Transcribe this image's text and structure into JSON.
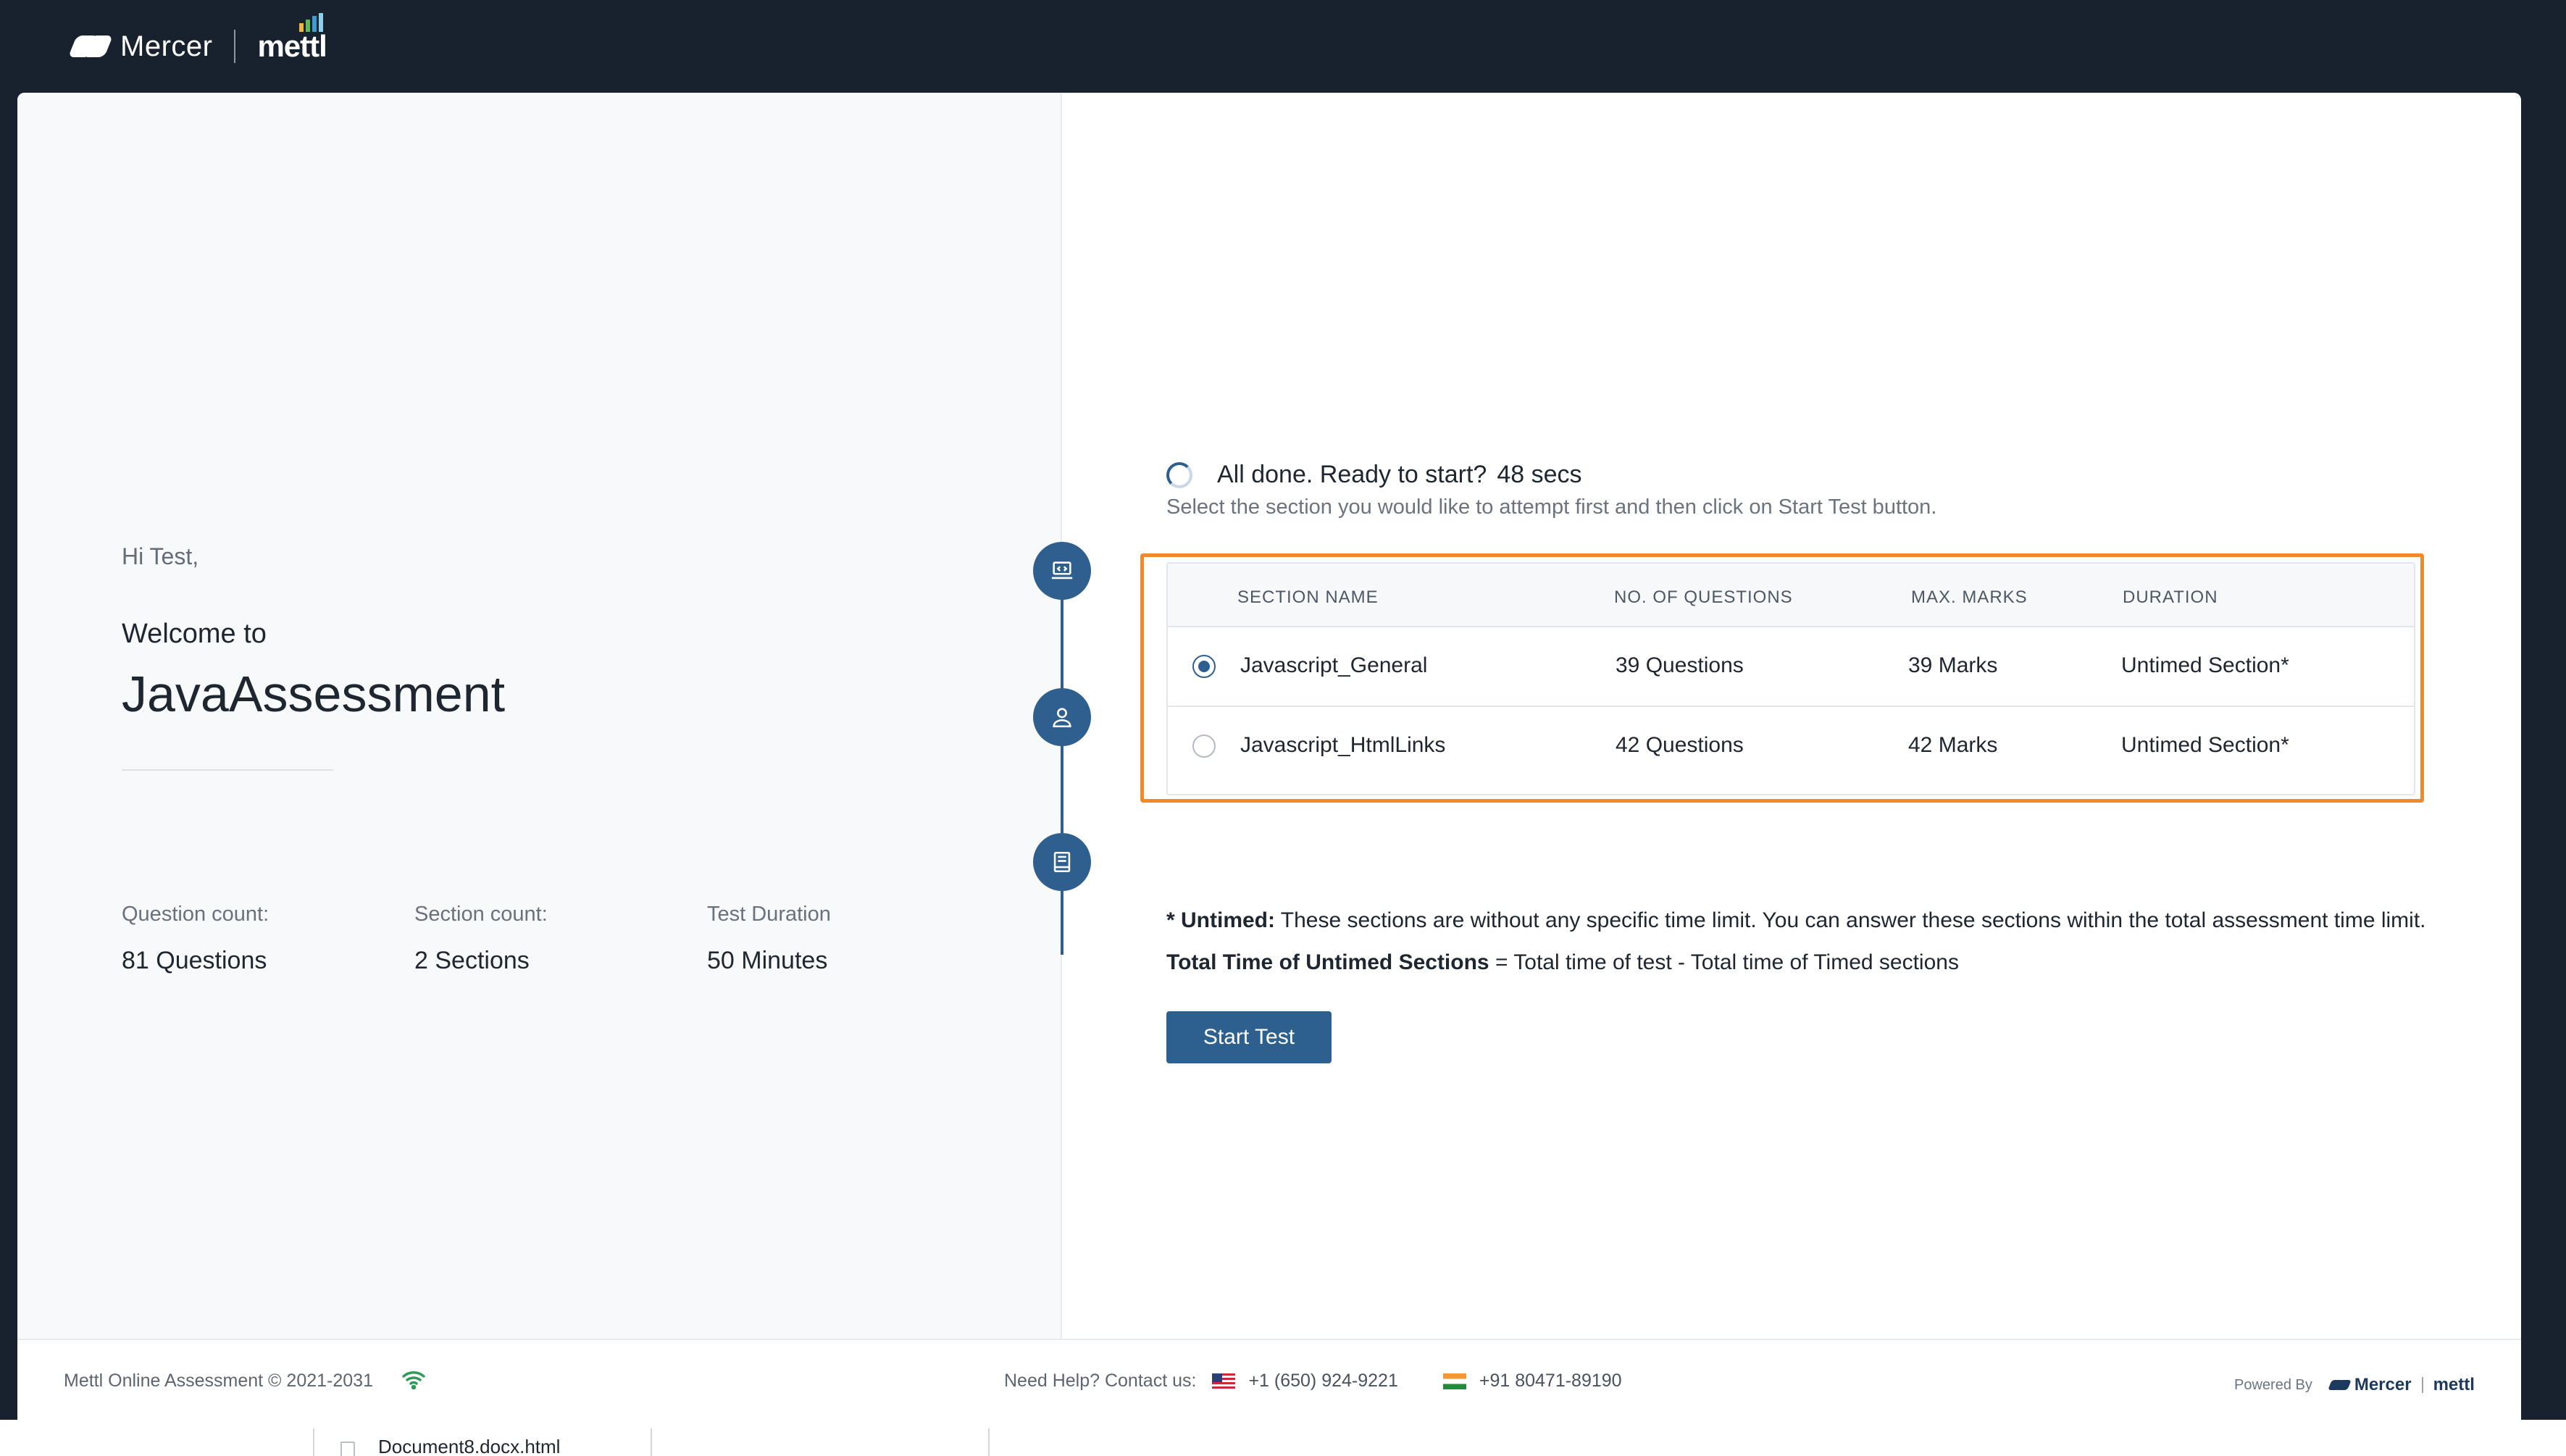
{
  "header": {
    "brand_name": "Mercer",
    "product_name": "mettl"
  },
  "welcome": {
    "greeting": "Hi Test,",
    "welcome_line": "Welcome to",
    "test_name": "JavaAssessment",
    "stats": [
      {
        "label": "Question count:",
        "value": "81 Questions"
      },
      {
        "label": "Section count:",
        "value": "2 Sections"
      },
      {
        "label": "Test Duration",
        "value": "50  Minutes"
      }
    ]
  },
  "timeline": {
    "steps": [
      {
        "icon": "laptop-code-icon"
      },
      {
        "icon": "user-icon"
      },
      {
        "icon": "book-icon"
      }
    ]
  },
  "ready": {
    "title": "All done. Ready to start?",
    "countdown": "48 secs",
    "instruction": "Select the section you would like to attempt first and then click on Start Test button."
  },
  "sections": {
    "columns": [
      "Section Name",
      "No. of Questions",
      "Max. Marks",
      "Duration"
    ],
    "rows": [
      {
        "name": "Javascript_General",
        "questions": "39 Questions",
        "marks": "39 Marks",
        "duration": "Untimed Section*",
        "selected": true
      },
      {
        "name": "Javascript_HtmlLinks",
        "questions": "42 Questions",
        "marks": "42 Marks",
        "duration": "Untimed Section*",
        "selected": false
      }
    ]
  },
  "notes": {
    "untimed_label": "* Untimed:",
    "untimed_text": " These sections are without any specific time limit. You can answer these sections within the total assessment time limit.",
    "formula_label": "Total Time of Untimed Sections",
    "formula_text": " = Total time of test - Total time of Timed sections"
  },
  "actions": {
    "start_label": "Start Test"
  },
  "footer": {
    "copyright": "Mettl Online Assessment © 2021-2031",
    "help_label": "Need Help? Contact us:",
    "phone_us": "+1 (650) 924-9221",
    "phone_in": "+91 80471-89190",
    "powered_by": "Powered By",
    "powered_brand": "Mercer",
    "powered_product": "mettl"
  },
  "downloads": {
    "file": "Document8.docx.html"
  },
  "colors": {
    "accent": "#2f5f8f",
    "highlight_frame": "#f0892a",
    "topbar": "#18222f"
  }
}
